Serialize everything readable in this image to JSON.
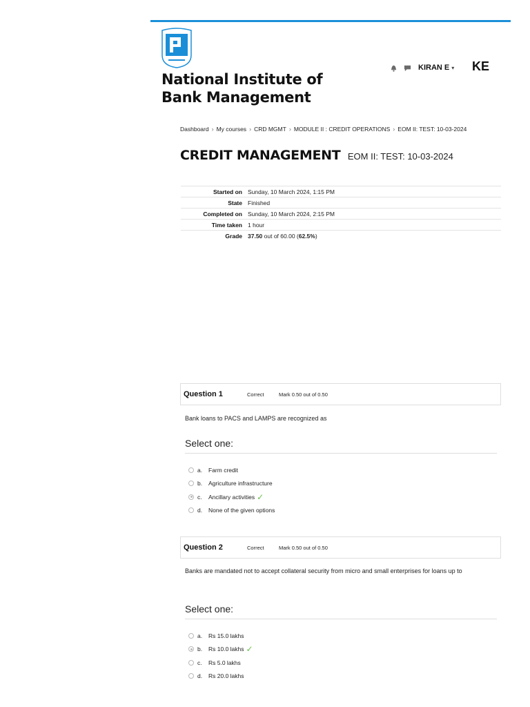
{
  "colors": {
    "accent": "#1a8fd8",
    "correct": "#6cc04a",
    "logo": "#1a8fd8"
  },
  "site": {
    "name_line1": "National Institute of",
    "name_line2": "Bank Management"
  },
  "user": {
    "name": "KIRAN E",
    "initials": "KE",
    "icons": [
      "bell-icon",
      "chat-icon"
    ]
  },
  "breadcrumb": [
    "Dashboard",
    "My courses",
    "CRD MGMT",
    "MODULE II : CREDIT OPERATIONS",
    "EOM II: TEST: 10-03-2024"
  ],
  "page": {
    "title": "CREDIT MANAGEMENT",
    "subtitle": "EOM II: TEST: 10-03-2024"
  },
  "summary": {
    "started_label": "Started on",
    "started_value": "Sunday, 10 March 2024, 1:15 PM",
    "state_label": "State",
    "state_value": "Finished",
    "completed_label": "Completed on",
    "completed_value": "Sunday, 10 March 2024, 2:15 PM",
    "time_label": "Time taken",
    "time_value": "1 hour",
    "grade_label": "Grade",
    "grade_score": "37.50",
    "grade_mid": " out of 60.00 (",
    "grade_percent": "62.5%",
    "grade_end": ")"
  },
  "questions": [
    {
      "number_label": "Question 1",
      "state": "Correct",
      "mark": "Mark 0.50 out of 0.50",
      "text": "Bank loans to PACS and LAMPS are recognized as",
      "prompt": "Select one:",
      "answers": [
        {
          "letter": "a.",
          "text": "Farm credit",
          "selected": false
        },
        {
          "letter": "b.",
          "text": "Agriculture infrastructure",
          "selected": false
        },
        {
          "letter": "c.",
          "text": "Ancillary activities",
          "selected": true
        },
        {
          "letter": "d.",
          "text": "None of the given options",
          "selected": false
        }
      ]
    },
    {
      "number_label": "Question 2",
      "state": "Correct",
      "mark": "Mark 0.50 out of 0.50",
      "text": "Banks are mandated not to accept collateral security from micro and small enterprises for loans up to",
      "prompt": "Select one:",
      "answers": [
        {
          "letter": "a.",
          "text": "Rs 15.0 lakhs",
          "selected": false
        },
        {
          "letter": "b.",
          "text": "Rs 10.0 lakhs",
          "selected": true
        },
        {
          "letter": "c.",
          "text": "Rs 5.0 lakhs",
          "selected": false
        },
        {
          "letter": "d.",
          "text": "Rs 20.0 lakhs",
          "selected": false
        }
      ]
    }
  ]
}
